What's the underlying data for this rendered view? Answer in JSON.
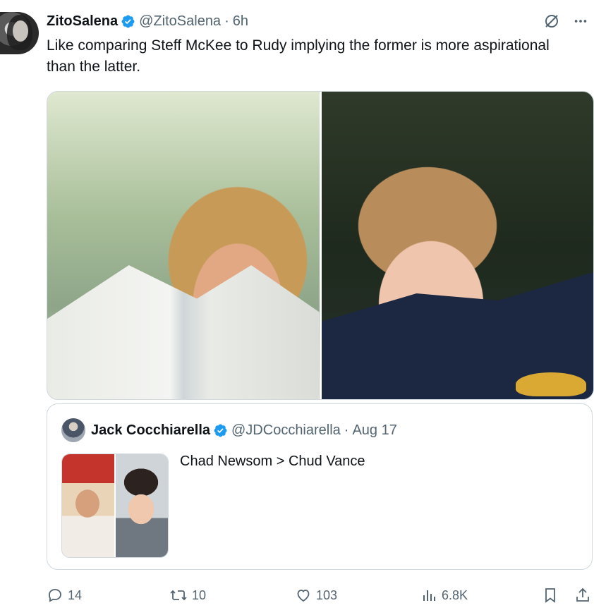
{
  "tweet": {
    "author_name": "ZitoSalena",
    "handle": "@ZitoSalena",
    "separator": "·",
    "time": "6h",
    "text": "Like comparing Steff McKee to Rudy implying the former is more aspirational than the latter."
  },
  "quoted_tweet": {
    "author_name": "Jack Cocchiarella",
    "handle": "@JDCocchiarella",
    "separator": "·",
    "date": "Aug 17",
    "text": "Chad Newsom > Chud Vance"
  },
  "actions": {
    "replies": "14",
    "reposts": "10",
    "likes": "103",
    "views": "6.8K"
  },
  "icons": {
    "verified": "verified-badge-icon",
    "grok": "grok-icon",
    "more": "more-icon",
    "reply": "reply-icon",
    "repost": "repost-icon",
    "like": "heart-icon",
    "views": "views-icon",
    "bookmark": "bookmark-icon",
    "share": "share-icon"
  },
  "colors": {
    "verified": "#1d9bf0",
    "text": "#0f1419",
    "secondary": "#536471",
    "border": "#cfd9de"
  }
}
